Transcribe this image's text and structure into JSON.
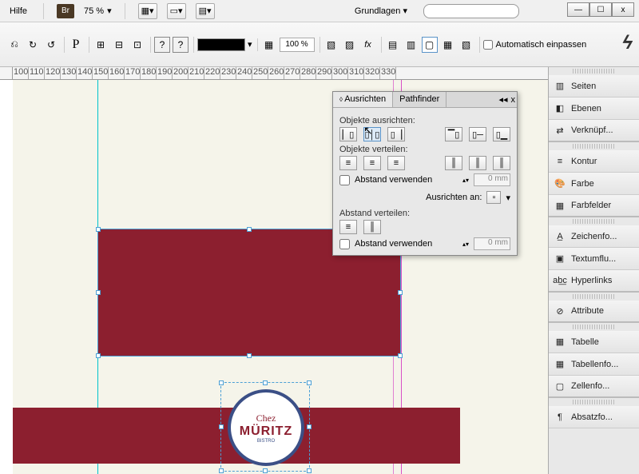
{
  "menubar": {
    "help": "Hilfe",
    "bridge": "Br",
    "zoom": "75 %",
    "workspace": "Grundlagen",
    "win_min": "—",
    "win_max": "☐",
    "win_close": "x"
  },
  "optbar": {
    "pct": "100 %",
    "autofit": "Automatisch einpassen"
  },
  "ruler": [
    "100",
    "110",
    "120",
    "130",
    "140",
    "150",
    "160",
    "170",
    "180",
    "190",
    "200",
    "210",
    "220",
    "230",
    "240",
    "250",
    "260",
    "270",
    "280",
    "290",
    "300",
    "310",
    "320",
    "330"
  ],
  "align": {
    "tab_align": "Ausrichten",
    "tab_pathfinder": "Pathfinder",
    "lbl_align": "Objekte ausrichten:",
    "lbl_distribute": "Objekte verteilen:",
    "lbl_spacing": "Abstand verwenden",
    "lbl_align_to": "Ausrichten an:",
    "lbl_dist_spacing": "Abstand verteilen:",
    "lbl_spacing2": "Abstand verwenden",
    "zero": "0 mm"
  },
  "panels": {
    "seiten": "Seiten",
    "ebenen": "Ebenen",
    "verknupf": "Verknüpf...",
    "kontur": "Kontur",
    "farbe": "Farbe",
    "farbfelder": "Farbfelder",
    "zeichen": "Zeichenfo...",
    "textumflu": "Textumflu...",
    "hyperlinks": "Hyperlinks",
    "attribute": "Attribute",
    "tabelle": "Tabelle",
    "tabellenfo": "Tabellenfo...",
    "zellenfo": "Zellenfo...",
    "absatzfo": "Absatzfo..."
  },
  "logo": {
    "top": "Chez",
    "main": "MÜRITZ",
    "sub": "BISTRO"
  }
}
